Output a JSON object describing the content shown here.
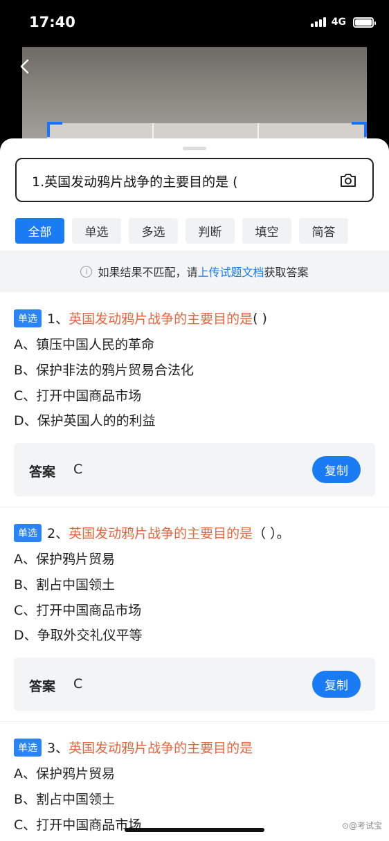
{
  "status": {
    "time": "17:40",
    "network": "4G"
  },
  "search": {
    "query": "1.英国发动鸦片战争的主要目的是 ("
  },
  "tabs": [
    {
      "label": "全部",
      "active": true
    },
    {
      "label": "单选",
      "active": false
    },
    {
      "label": "多选",
      "active": false
    },
    {
      "label": "判断",
      "active": false
    },
    {
      "label": "填空",
      "active": false
    },
    {
      "label": "简答",
      "active": false
    }
  ],
  "notice": {
    "prefix": "如果结果不匹配，请",
    "link": "上传试题文档",
    "suffix": "获取答案"
  },
  "questions": [
    {
      "type": "单选",
      "number": "1、",
      "text": "英国发动鸦片战争的主要目的是",
      "tail": "( )",
      "options": [
        "A、镇压中国人民的革命",
        "B、保护非法的鸦片贸易合法化",
        "C、打开中国商品市场",
        "D、保护英国人的的利益"
      ],
      "answer_label": "答案",
      "answer": "C",
      "copy_label": "复制"
    },
    {
      "type": "单选",
      "number": "2、",
      "text": "英国发动鸦片战争的主要目的是",
      "tail": "（ ）。",
      "options": [
        "A、保护鸦片贸易",
        "B、割占中国领土",
        "C、打开中国商品市场",
        "D、争取外交礼仪平等"
      ],
      "answer_label": "答案",
      "answer": "C",
      "copy_label": "复制"
    },
    {
      "type": "单选",
      "number": "3、",
      "text": "英国发动鸦片战争的主要目的是",
      "tail": "",
      "options": [
        "A、保护鸦片贸易",
        "B、割占中国领土",
        "C、打开中国商品市场"
      ]
    }
  ],
  "watermark": "⊙@考试宝",
  "colors": {
    "accent": "#1a7cf4",
    "question_text": "#e8643d"
  },
  "icons": [
    "back-arrow-icon",
    "camera-icon",
    "info-icon"
  ]
}
